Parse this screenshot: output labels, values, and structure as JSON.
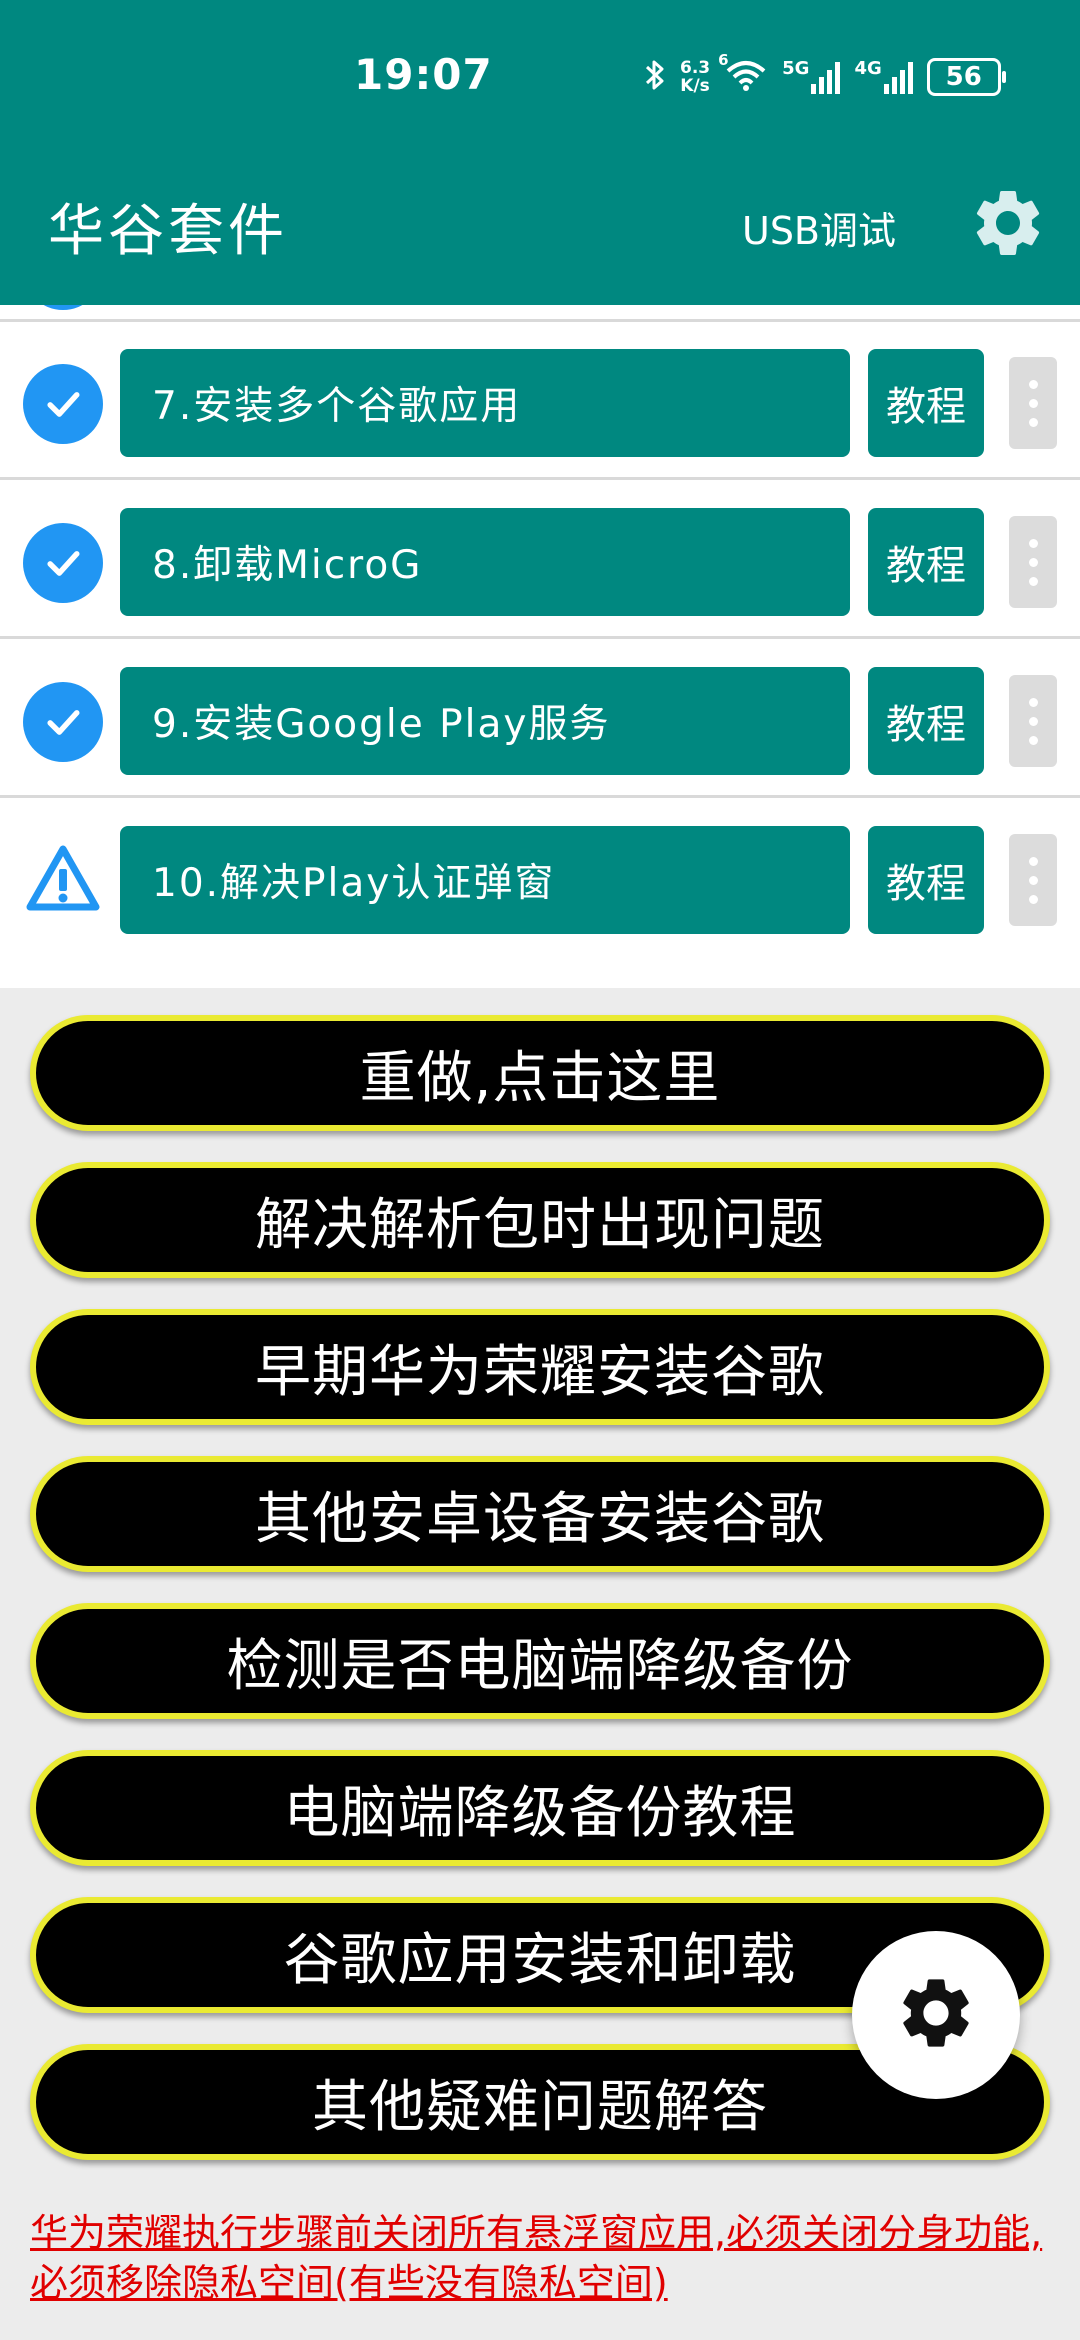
{
  "status_bar": {
    "time": "19:07",
    "net_speed_value": "6.3",
    "net_speed_unit": "K/s",
    "wifi_label": "6",
    "signal_5g": "5G",
    "signal_4g": "4G",
    "battery": "56",
    "icons": [
      "bluetooth-icon",
      "wifi-icon",
      "signal-5g-icon",
      "signal-4g-icon",
      "battery-icon"
    ]
  },
  "header": {
    "title": "华谷套件",
    "usb_label": "USB调试",
    "settings_icon": "gear-icon"
  },
  "colors": {
    "primary": "#008880",
    "check": "#2196f3",
    "pill_border": "#eaea32",
    "note": "#e00000"
  },
  "steps": [
    {
      "label": "7.安装多个谷歌应用",
      "tutorial": "教程",
      "status": "done"
    },
    {
      "label": "8.卸载MicroG",
      "tutorial": "教程",
      "status": "done"
    },
    {
      "label": "9.安装Google Play服务",
      "tutorial": "教程",
      "status": "done"
    },
    {
      "label": "10.解决Play认证弹窗",
      "tutorial": "教程",
      "status": "warning"
    }
  ],
  "actions": [
    "重做,点击这里",
    "解决解析包时出现问题",
    "早期华为荣耀安装谷歌",
    "其他安卓设备安装谷歌",
    "检测是否电脑端降级备份",
    "电脑端降级备份教程",
    "谷歌应用安装和卸载",
    "其他疑难问题解答"
  ],
  "footer_note": "华为荣耀执行步骤前关闭所有悬浮窗应用,必须关闭分身功能,必须移除隐私空间(有些没有隐私空间)"
}
